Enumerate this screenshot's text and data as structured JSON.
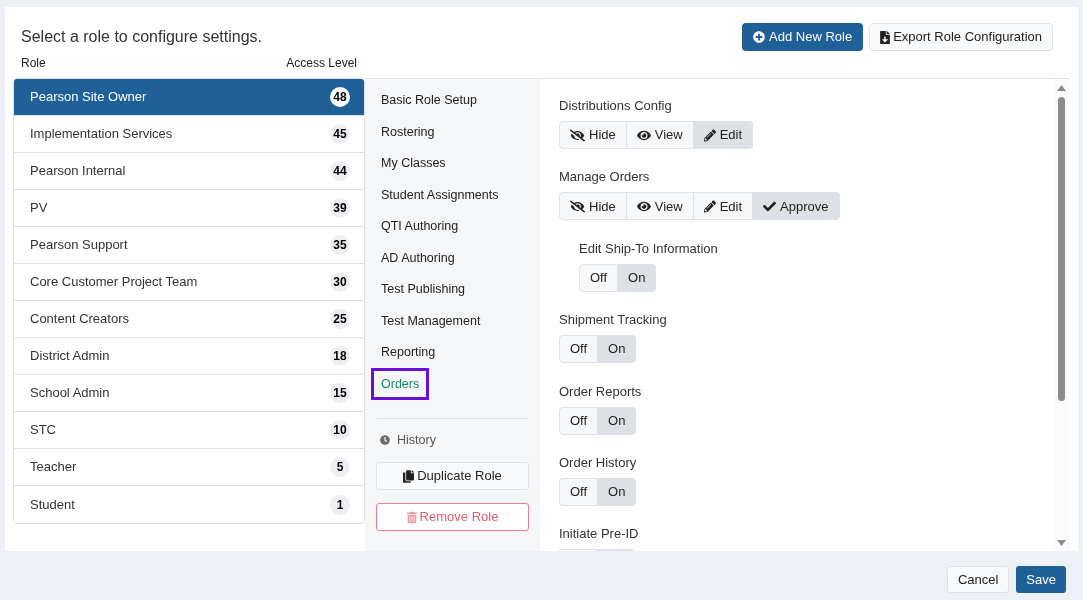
{
  "header": {
    "title": "Select a role to configure settings.",
    "buttons": [
      {
        "label": "Add New Role",
        "kind": "primary"
      },
      {
        "label": "Export Role Configuration",
        "kind": "secondary"
      }
    ]
  },
  "role_table": {
    "columns": [
      "Role",
      "Access Level"
    ],
    "rows": [
      {
        "name": "Pearson Site Owner",
        "access_level": "48",
        "selected": true
      },
      {
        "name": "Implementation Services",
        "access_level": "45",
        "selected": false
      },
      {
        "name": "Pearson Internal",
        "access_level": "44",
        "selected": false
      },
      {
        "name": "PV",
        "access_level": "39",
        "selected": false
      },
      {
        "name": "Pearson Support",
        "access_level": "35",
        "selected": false
      },
      {
        "name": "Core Customer Project Team",
        "access_level": "30",
        "selected": false
      },
      {
        "name": "Content Creators",
        "access_level": "25",
        "selected": false
      },
      {
        "name": "District Admin",
        "access_level": "18",
        "selected": false
      },
      {
        "name": "School Admin",
        "access_level": "15",
        "selected": false
      },
      {
        "name": "STC",
        "access_level": "10",
        "selected": false
      },
      {
        "name": "Teacher",
        "access_level": "5",
        "selected": false
      },
      {
        "name": "Student",
        "access_level": "1",
        "selected": false
      }
    ]
  },
  "settings_nav": {
    "items": [
      {
        "label": "Basic Role Setup",
        "selected": false
      },
      {
        "label": "Rostering",
        "selected": false
      },
      {
        "label": "My Classes",
        "selected": false
      },
      {
        "label": "Student Assignments",
        "selected": false
      },
      {
        "label": "QTI Authoring",
        "selected": false
      },
      {
        "label": "AD Authoring",
        "selected": false
      },
      {
        "label": "Test Publishing",
        "selected": false
      },
      {
        "label": "Test Management",
        "selected": false
      },
      {
        "label": "Reporting",
        "selected": false
      },
      {
        "label": "Orders",
        "selected": true
      }
    ],
    "history_link": "History",
    "actions": [
      {
        "label": "Duplicate Role",
        "kind": "duplicate"
      },
      {
        "label": "Remove Role",
        "kind": "remove"
      }
    ]
  },
  "permissions": [
    {
      "label": "Distributions Config",
      "kind": "access",
      "options": [
        {
          "label": "Hide",
          "selected": false
        },
        {
          "label": "View",
          "selected": false
        },
        {
          "label": "Edit",
          "selected": true
        }
      ]
    },
    {
      "label": "Manage Orders",
      "kind": "access",
      "options": [
        {
          "label": "Hide",
          "selected": false
        },
        {
          "label": "View",
          "selected": false
        },
        {
          "label": "Edit",
          "selected": false
        },
        {
          "label": "Approve",
          "selected": true
        }
      ],
      "children": [
        {
          "label": "Edit Ship-To Information",
          "kind": "toggle",
          "options": [
            {
              "label": "Off",
              "selected": false
            },
            {
              "label": "On",
              "selected": true
            }
          ]
        }
      ]
    },
    {
      "label": "Shipment Tracking",
      "kind": "toggle",
      "options": [
        {
          "label": "Off",
          "selected": false
        },
        {
          "label": "On",
          "selected": true
        }
      ]
    },
    {
      "label": "Order Reports",
      "kind": "toggle",
      "options": [
        {
          "label": "Off",
          "selected": false
        },
        {
          "label": "On",
          "selected": true
        }
      ]
    },
    {
      "label": "Order History",
      "kind": "toggle",
      "options": [
        {
          "label": "Off",
          "selected": false
        },
        {
          "label": "On",
          "selected": true
        }
      ]
    },
    {
      "label": "Initiate Pre-ID",
      "kind": "toggle"
    }
  ],
  "footer": {
    "buttons": [
      {
        "label": "Cancel",
        "kind": "secondary"
      },
      {
        "label": "Save",
        "kind": "primary"
      }
    ]
  }
}
